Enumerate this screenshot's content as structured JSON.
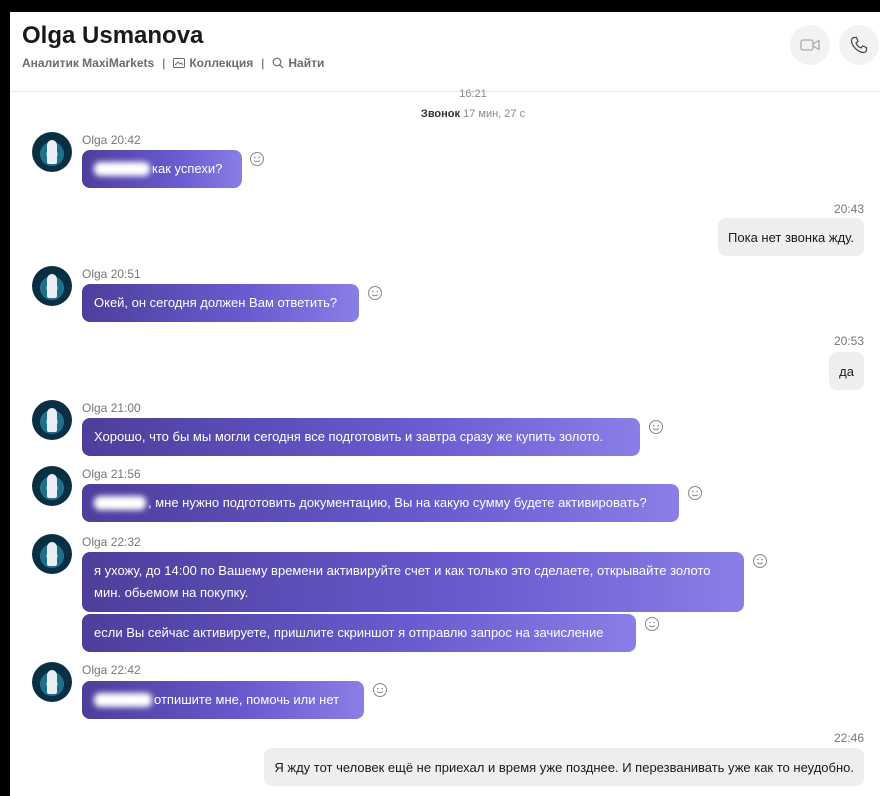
{
  "header": {
    "contact_name": "Olga Usmanova",
    "subtitle": "Аналитик MaxiMarkets",
    "collection_label": "Коллекция",
    "find_label": "Найти",
    "separator": "|"
  },
  "conversation": {
    "system_time": "16:21",
    "call_label": "Звонок",
    "call_duration": "17 мин, 27 с",
    "messages": [
      {
        "author": "Olga",
        "time": "20:42",
        "text": "как успехи?"
      },
      {
        "time": "20:43",
        "text": "Пока нет звонка жду."
      },
      {
        "author": "Olga",
        "time": "20:51",
        "text": "Окей, он сегодня должен Вам ответить?"
      },
      {
        "time": "20:53",
        "text": "да"
      },
      {
        "author": "Olga",
        "time": "21:00",
        "text": "Хорошо, что бы мы могли сегодня все подготовить и завтра сразу же купить золото."
      },
      {
        "author": "Olga",
        "time": "21:56",
        "text": ", мне нужно подготовить документацию, Вы на какую сумму будете активировать?"
      },
      {
        "author": "Olga",
        "time": "22:32",
        "text": "я ухожу, до 14:00 по Вашему времени активируйте счет и как только это сделаете, открывайте золото мин. обьемом на покупку.",
        "text2": "если Вы сейчас активируете, пришлите скриншот я отправлю запрос на зачисление"
      },
      {
        "author": "Olga",
        "time": "22:42",
        "text": "отпишите мне, помочь или нет"
      },
      {
        "time": "22:46",
        "text": "Я жду тот человек ещё не приехал и время уже позднее. И перезванивать уже как то неудобно."
      }
    ]
  }
}
